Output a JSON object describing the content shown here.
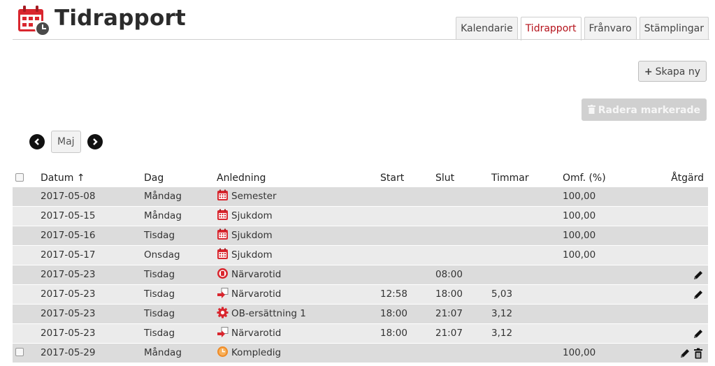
{
  "header": {
    "title": "Tidrapport",
    "tabs": [
      {
        "label": "Kalendarie",
        "active": false
      },
      {
        "label": "Tidrapport",
        "active": true
      },
      {
        "label": "Frånvaro",
        "active": false
      },
      {
        "label": "Stämplingar",
        "active": false
      }
    ]
  },
  "actions": {
    "create_label": "Skapa ny",
    "delete_label": "Radera markerade"
  },
  "month_nav": {
    "month": "Maj"
  },
  "table": {
    "headers": {
      "date": "Datum ↑",
      "day": "Dag",
      "reason": "Anledning",
      "start": "Start",
      "end": "Slut",
      "hours": "Timmar",
      "pct": "Omf. (%)",
      "action": "Åtgärd"
    },
    "rows": [
      {
        "date": "2017-05-08",
        "day": "Måndag",
        "reason": "Semester",
        "icon": "calendar-icon",
        "start": "",
        "end": "",
        "hours": "",
        "pct": "100,00",
        "edit": false,
        "del": false,
        "checkbox": false
      },
      {
        "date": "2017-05-15",
        "day": "Måndag",
        "reason": "Sjukdom",
        "icon": "calendar-icon",
        "start": "",
        "end": "",
        "hours": "",
        "pct": "100,00",
        "edit": false,
        "del": false,
        "checkbox": false
      },
      {
        "date": "2017-05-16",
        "day": "Tisdag",
        "reason": "Sjukdom",
        "icon": "calendar-icon",
        "start": "",
        "end": "",
        "hours": "",
        "pct": "100,00",
        "edit": false,
        "del": false,
        "checkbox": false
      },
      {
        "date": "2017-05-17",
        "day": "Onsdag",
        "reason": "Sjukdom",
        "icon": "calendar-icon",
        "start": "",
        "end": "",
        "hours": "",
        "pct": "100,00",
        "edit": false,
        "del": false,
        "checkbox": false
      },
      {
        "date": "2017-05-23",
        "day": "Tisdag",
        "reason": "Närvarotid",
        "icon": "stop-clock-icon",
        "start": "",
        "end": "08:00",
        "hours": "",
        "pct": "",
        "edit": true,
        "del": false,
        "checkbox": false
      },
      {
        "date": "2017-05-23",
        "day": "Tisdag",
        "reason": "Närvarotid",
        "icon": "punch-arrow-icon",
        "start": "12:58",
        "end": "18:00",
        "hours": "5,03",
        "pct": "",
        "edit": true,
        "del": false,
        "checkbox": false
      },
      {
        "date": "2017-05-23",
        "day": "Tisdag",
        "reason": "OB-ersättning 1",
        "icon": "gear-icon",
        "start": "18:00",
        "end": "21:07",
        "hours": "3,12",
        "pct": "",
        "edit": false,
        "del": false,
        "checkbox": false
      },
      {
        "date": "2017-05-23",
        "day": "Tisdag",
        "reason": "Närvarotid",
        "icon": "punch-arrow-icon",
        "start": "18:00",
        "end": "21:07",
        "hours": "3,12",
        "pct": "",
        "edit": true,
        "del": false,
        "checkbox": false
      },
      {
        "date": "2017-05-29",
        "day": "Måndag",
        "reason": "Kompledig",
        "icon": "clock-orange-icon",
        "start": "",
        "end": "",
        "hours": "",
        "pct": "100,00",
        "edit": true,
        "del": true,
        "checkbox": true
      }
    ]
  },
  "colors": {
    "accent": "#b5121b",
    "row_odd": "#dcdcdc",
    "row_even": "#ebebeb",
    "orange": "#f08a24"
  }
}
